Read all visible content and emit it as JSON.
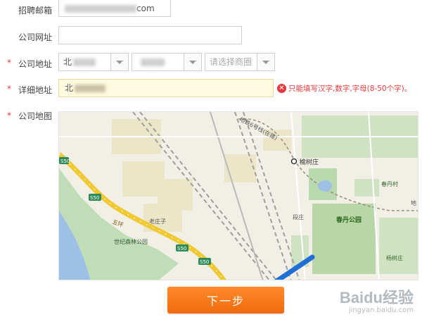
{
  "form": {
    "email": {
      "label": "招聘邮箱",
      "value_suffix": "com"
    },
    "website": {
      "label": "公司网址",
      "value": ""
    },
    "address": {
      "label": "公司地址",
      "province_value": "北",
      "city_value": "",
      "district_placeholder": "请选择商圈"
    },
    "detail_address": {
      "label": "详细地址",
      "value": "北",
      "error": "只能填写汉字,数字,字母(8-50个字)。"
    },
    "map": {
      "label": "公司地图",
      "labels": {
        "subway": "地铁6号线(在建)",
        "yushuzhuang": "榆树庄",
        "chundan_village": "春丹村",
        "laozhuangzi": "老庄子",
        "duanzhuang": "段庄",
        "chundan_park": "春丹公园",
        "yangshuzhuang": "杨树庄",
        "century_forest_park": "世纪森林公园",
        "ring_road": "五环",
        "rail_right": "地"
      },
      "shields": [
        "S50",
        "S50",
        "S50",
        "S50"
      ]
    }
  },
  "actions": {
    "next_label": "下一步"
  },
  "watermark": {
    "brand": "Baidu经验",
    "domain": "jingyan.baidu.com"
  },
  "colors": {
    "accent": "#f26b0f",
    "error": "#e4393c",
    "highlight_field": "#fffbe0"
  }
}
